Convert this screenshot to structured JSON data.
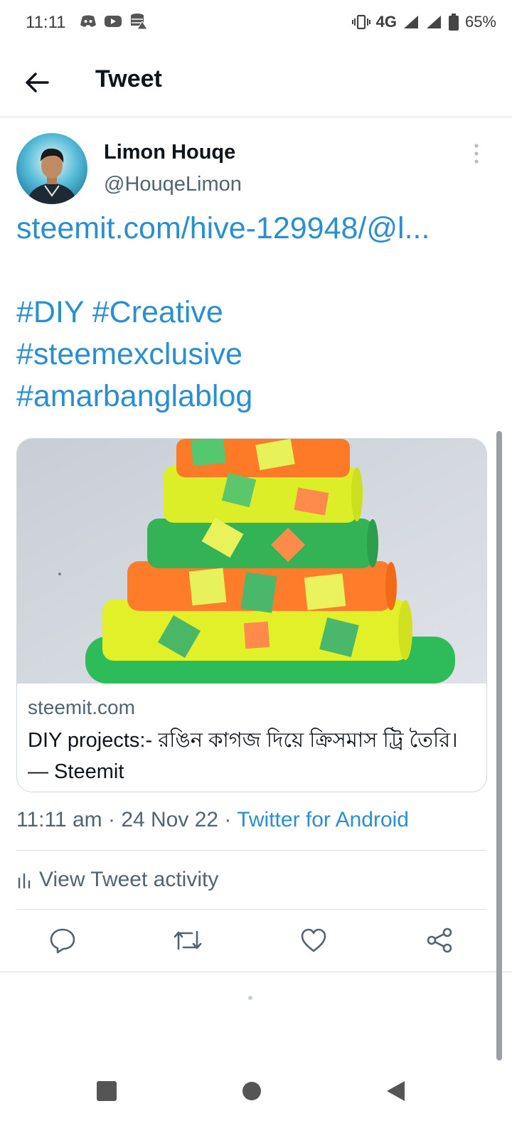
{
  "status_bar": {
    "time": "11:11",
    "network": "4G",
    "battery": "65%",
    "icons": [
      "discord-icon",
      "youtube-icon",
      "data-saver-icon",
      "vibrate-icon",
      "signal-icon",
      "battery-icon"
    ]
  },
  "app_bar": {
    "title": "Tweet",
    "back_icon": "arrow-left-icon"
  },
  "tweet": {
    "author": {
      "name": "Limon Houqe",
      "handle": "@HouqeLimon"
    },
    "more_icon": "more-vertical-icon",
    "link": "steemit.com/hive-129948/@l...",
    "hashtag_lines": [
      "#DIY #Creative",
      "#steemexclusive",
      "#amarbanglablog"
    ],
    "card": {
      "domain": "steemit.com",
      "title": "DIY projects:- রঙিন কাগজ দিয়ে ক্রিসমাস ট্রি তৈরি। — Steemit"
    },
    "meta": {
      "time": "11:11 am",
      "date": "24 Nov 22",
      "source": "Twitter for Android"
    },
    "activity_label": "View Tweet activity",
    "actions": [
      "reply-icon",
      "retweet-icon",
      "like-icon",
      "share-icon"
    ]
  },
  "nav_bar": {
    "buttons": [
      "recents-square-icon",
      "home-circle-icon",
      "back-triangle-icon"
    ]
  },
  "colors": {
    "link": "#2a8fd1",
    "secondary_text": "#536471",
    "divider": "#dcdfe3"
  }
}
